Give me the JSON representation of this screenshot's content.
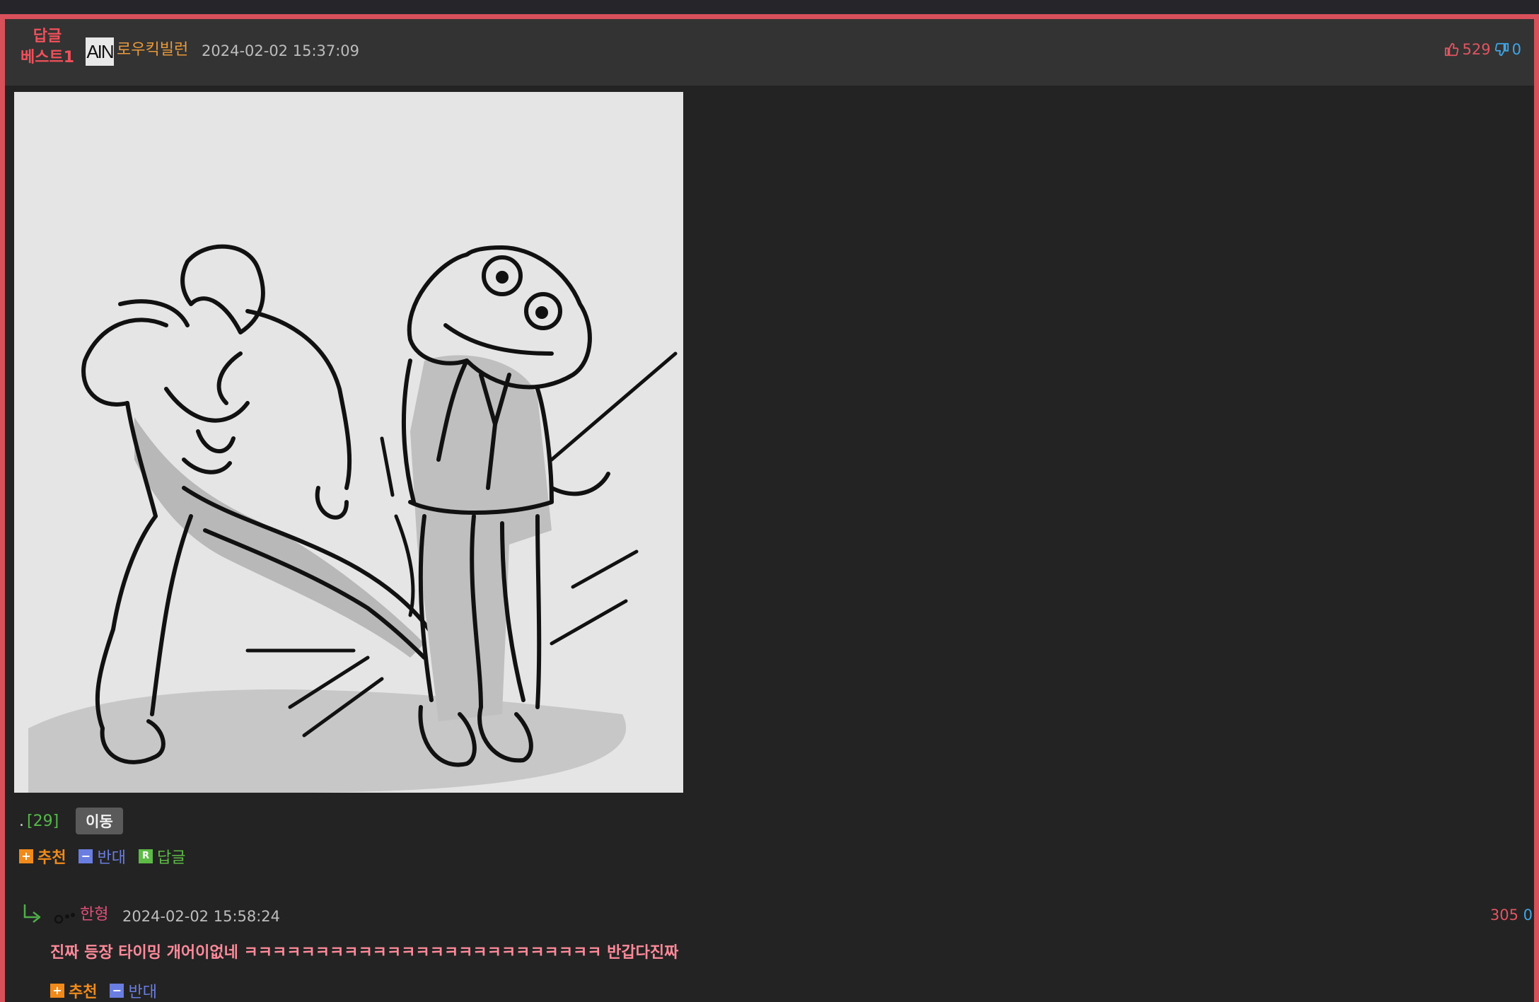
{
  "best_badge": {
    "line1": "답글",
    "line2": "베스트1"
  },
  "post": {
    "avatar_text": "AIN",
    "author": "로우킥빌런",
    "timestamp": "2024-02-02 15:37:09",
    "upvotes": "529",
    "downvotes": "0"
  },
  "link": {
    "dot": ".",
    "count": "[29]",
    "move_label": "이동"
  },
  "actions": {
    "recommend": "추천",
    "oppose": "반대",
    "reply": "답글",
    "reply_icon": "R"
  },
  "reply": {
    "author": "한형",
    "timestamp": "2024-02-02 15:58:24",
    "upvotes": "305",
    "downvotes": "0",
    "text": "진짜 등장 타이밍 개어이없네 ㅋㅋㅋㅋㅋㅋㅋㅋㅋㅋㅋㅋㅋㅋㅋㅋㅋㅋㅋㅋㅋㅋㅋㅋㅋ 반갑다진짜",
    "recommend": "추천",
    "oppose": "반대"
  },
  "colors": {
    "accent_border": "#d8505a",
    "badge": "#f0505a",
    "author": "#e89a3a",
    "recommend": "#f08a1a",
    "oppose": "#6a7de0",
    "reply": "#5dbb46",
    "reply_text": "#ff8a9a",
    "upvote": "#e05560",
    "downvote": "#3fa6e6"
  },
  "icons": {
    "thumbs_up": "thumbs-up-icon",
    "thumbs_down": "thumbs-down-icon",
    "reply_arrow": "reply-arrow-icon",
    "plus": "plus-icon",
    "minus": "minus-icon"
  }
}
